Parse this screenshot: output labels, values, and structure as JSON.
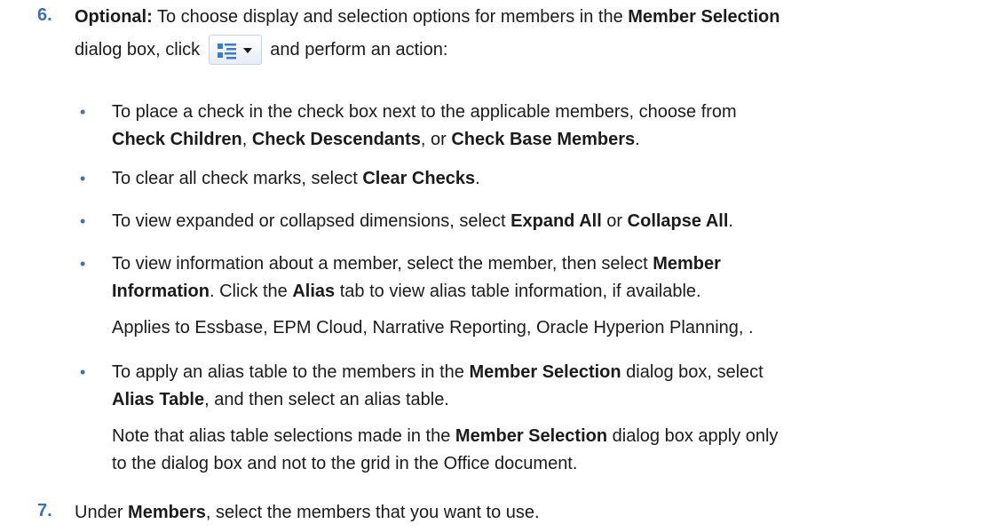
{
  "step6": {
    "number": "6.",
    "prefix_bold": "Optional:",
    "text_a": " To choose display and selection options for members in the ",
    "bold_a": "Member Selection",
    "text_b": "dialog box, click ",
    "text_c": " and perform an action:",
    "toolbar_button_icon": "member-options-dropdown-icon"
  },
  "bullets": {
    "b1": {
      "t1": "To place a check in the check box next to the applicable members, choose from",
      "bold1": "Check Children",
      "t2": ", ",
      "bold2": "Check Descendants",
      "t3": ", or ",
      "bold3": "Check Base Members",
      "t4": "."
    },
    "b2": {
      "t1": "To clear all check marks, select ",
      "bold1": "Clear Checks",
      "t2": "."
    },
    "b3": {
      "t1": "To view expanded or collapsed dimensions, select ",
      "bold1": "Expand All",
      "t2": " or ",
      "bold2": "Collapse All",
      "t3": "."
    },
    "b4": {
      "t1": "To view information about a member, select the member, then select ",
      "bold1": "Member",
      "bold1b": "Information",
      "t2": ". Click the ",
      "bold2": "Alias",
      "t3": " tab to view alias table information, if available.",
      "note": "Applies to Essbase, EPM Cloud, Narrative Reporting, Oracle Hyperion Planning, ."
    },
    "b5": {
      "t1": "To apply an alias table to the members in the ",
      "bold1": "Member Selection",
      "t2": " dialog box, select",
      "bold2": "Alias Table",
      "t3": ", and then select an alias table.",
      "note_t1": "Note that alias table selections made in the ",
      "note_bold1": "Member Selection",
      "note_t2": " dialog box apply only",
      "note_t3": "to the dialog box and not to the grid in the Office document."
    }
  },
  "step7": {
    "number": "7.",
    "t1": "Under ",
    "bold1": "Members",
    "t2": ", select the members that you want to use."
  },
  "colors": {
    "step_number": "#3b6fb6",
    "text": "#1b1b1b",
    "bullet": "#3b6fb6"
  }
}
